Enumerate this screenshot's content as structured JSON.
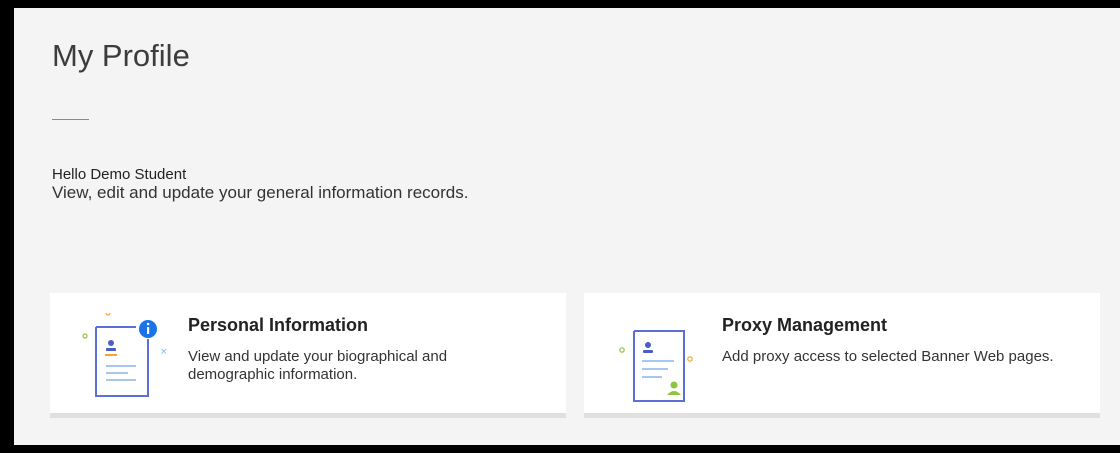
{
  "page": {
    "title": "My Profile",
    "greeting": "Hello Demo Student",
    "intro": "View, edit and update your general information records."
  },
  "cards": [
    {
      "title": "Personal Information",
      "description": "View and update your biographical and demographic information.",
      "icon": "personal-info-icon"
    },
    {
      "title": "Proxy Management",
      "description": "Add proxy access to selected Banner Web pages.",
      "icon": "proxy-management-icon"
    }
  ],
  "colors": {
    "background": "#f4f4f4",
    "card": "#ffffff",
    "icon_outline": "#5b6fd6",
    "info_badge": "#1a73e8",
    "accent_orange": "#f4a62a",
    "accent_green": "#8cc63f",
    "accent_light_blue": "#a7c6f0"
  }
}
